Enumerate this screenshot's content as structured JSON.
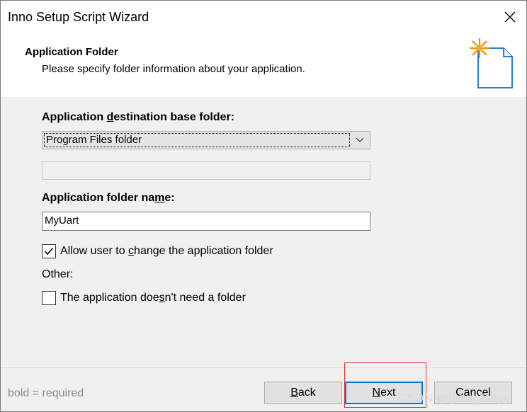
{
  "window": {
    "title": "Inno Setup Script Wizard"
  },
  "header": {
    "title": "Application Folder",
    "subtitle": "Please specify folder information about your application.",
    "icon": "wizard-document-sparkle-icon"
  },
  "form": {
    "dest_label_pre": "Application ",
    "dest_label_access": "d",
    "dest_label_post": "estination base folder:",
    "dest_selected": "Program Files folder",
    "dest_custom_value": "",
    "name_label_pre": "Application folder na",
    "name_label_access": "m",
    "name_label_post": "e:",
    "name_value": "MyUart",
    "allow_change": {
      "checked": true,
      "label_pre": "Allow user to ",
      "label_access": "c",
      "label_post": "hange the application folder"
    },
    "other_label": "Other:",
    "no_folder": {
      "checked": false,
      "label_pre": "The application doe",
      "label_access": "s",
      "label_post": "n't need a folder"
    }
  },
  "footer": {
    "note": "bold = required",
    "back_access": "B",
    "back_rest": "ack",
    "next_access": "N",
    "next_rest": "ext",
    "cancel_label": "Cancel"
  },
  "watermark": "CSDN @gdut_likkyy",
  "colors": {
    "accent": "#0078d7",
    "highlight_box": "#e03030",
    "icon_sparkle": "#f08c00",
    "icon_doc": "#2a7fd0"
  }
}
